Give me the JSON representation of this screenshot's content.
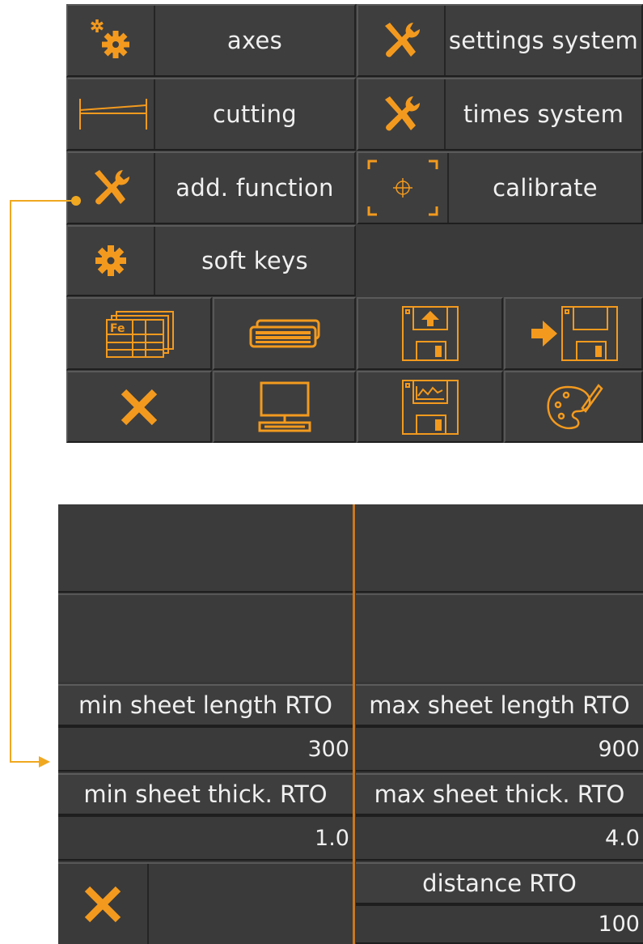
{
  "accent_color": "#f39a1e",
  "menu": {
    "axes_label": "axes",
    "settings_system_label": "settings system",
    "cutting_label": "cutting",
    "times_system_label": "times system",
    "add_function_label": "add. function",
    "calibrate_label": "calibrate",
    "soft_keys_label": "soft keys",
    "icons_row1": [
      "fe-table-icon",
      "keyboard-icon",
      "floppy-upload-icon",
      "floppy-import-icon"
    ],
    "icons_row2": [
      "close-icon",
      "monitor-icon",
      "floppy-chart-icon",
      "palette-icon"
    ]
  },
  "rto": {
    "min_sheet_length_label": "min sheet length RTO",
    "min_sheet_length_value": "300",
    "max_sheet_length_label": "max sheet length RTO",
    "max_sheet_length_value": "900",
    "min_sheet_thick_label": "min sheet thick. RTO",
    "min_sheet_thick_value": "1.0",
    "max_sheet_thick_label": "max sheet thick. RTO",
    "max_sheet_thick_value": "4.0",
    "distance_label": "distance RTO",
    "distance_value": "100"
  }
}
